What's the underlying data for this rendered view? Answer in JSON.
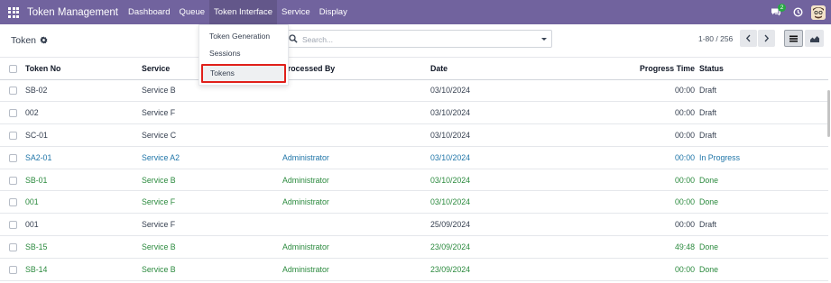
{
  "navbar": {
    "app_title": "Token Management",
    "menu": [
      "Dashboard",
      "Queue",
      "Token Interface",
      "Service",
      "Display"
    ],
    "chat_badge": "2"
  },
  "control_panel": {
    "title": "Token",
    "search_placeholder": "Search...",
    "pager": "1-80 / 256"
  },
  "dropdown": {
    "items": [
      "Token Generation",
      "Sessions",
      "Tokens"
    ],
    "selected": "Tokens"
  },
  "table": {
    "headers": [
      "Token No",
      "Service",
      "Processed By",
      "Date",
      "Progress Time",
      "Status"
    ],
    "rows": [
      {
        "token": "SB-02",
        "service": "Service B",
        "processed_by": "",
        "date": "03/10/2024",
        "progress": "00:00",
        "status": "Draft"
      },
      {
        "token": "002",
        "service": "Service F",
        "processed_by": "",
        "date": "03/10/2024",
        "progress": "00:00",
        "status": "Draft"
      },
      {
        "token": "SC-01",
        "service": "Service C",
        "processed_by": "",
        "date": "03/10/2024",
        "progress": "00:00",
        "status": "Draft"
      },
      {
        "token": "SA2-01",
        "service": "Service A2",
        "processed_by": "Administrator",
        "date": "03/10/2024",
        "progress": "00:00",
        "status": "In Progress"
      },
      {
        "token": "SB-01",
        "service": "Service B",
        "processed_by": "Administrator",
        "date": "03/10/2024",
        "progress": "00:00",
        "status": "Done"
      },
      {
        "token": "001",
        "service": "Service F",
        "processed_by": "Administrator",
        "date": "03/10/2024",
        "progress": "00:00",
        "status": "Done"
      },
      {
        "token": "001",
        "service": "Service F",
        "processed_by": "",
        "date": "25/09/2024",
        "progress": "00:00",
        "status": "Draft"
      },
      {
        "token": "SB-15",
        "service": "Service B",
        "processed_by": "Administrator",
        "date": "23/09/2024",
        "progress": "49:48",
        "status": "Done"
      },
      {
        "token": "SB-14",
        "service": "Service B",
        "processed_by": "Administrator",
        "date": "23/09/2024",
        "progress": "00:00",
        "status": "Done"
      }
    ]
  },
  "colors": {
    "navbar": "#71639e",
    "draft": "#374151",
    "in_progress": "#1f75a8",
    "done": "#2b8a3e",
    "highlight_border": "#e0201a"
  }
}
